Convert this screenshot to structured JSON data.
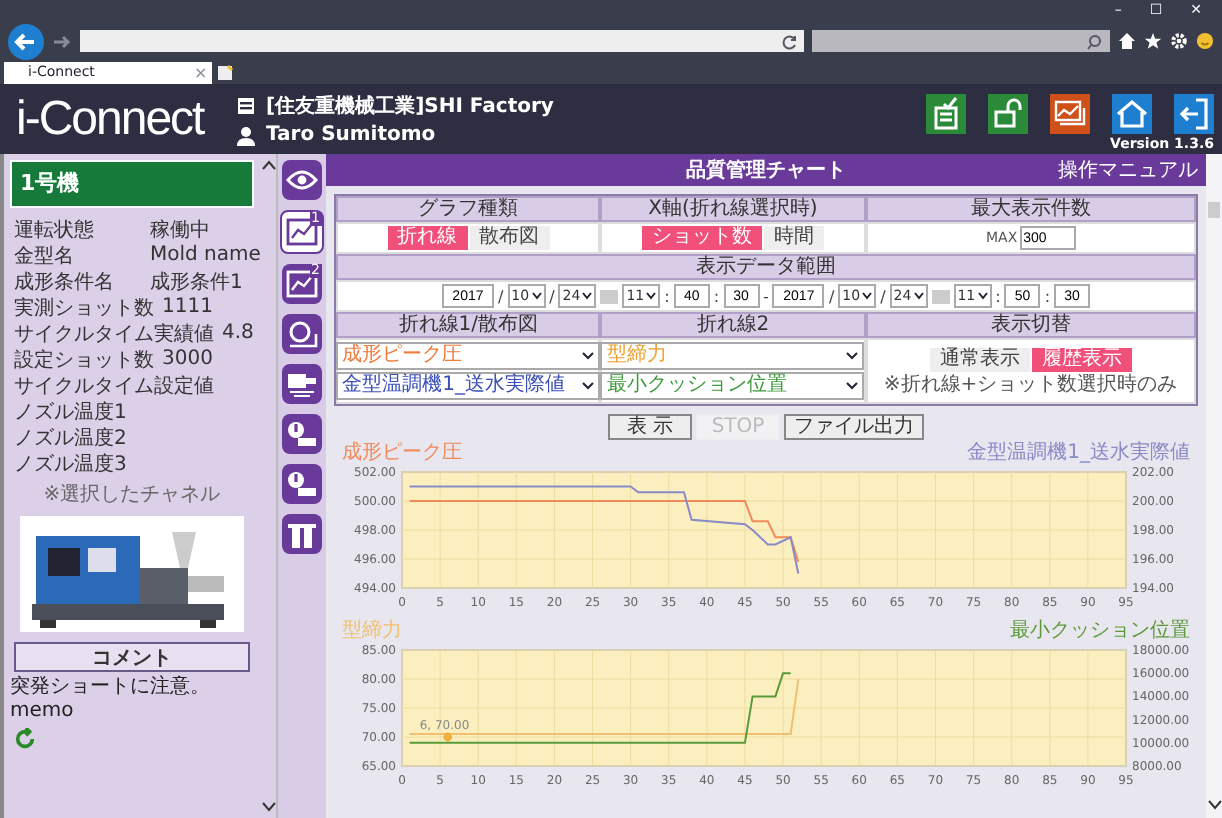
{
  "browser": {
    "tab_title": "i-Connect",
    "tab_close": "×",
    "window_controls": [
      "–",
      "☐",
      "✕"
    ]
  },
  "header": {
    "logo": "i-Connect",
    "factory": "[住友重機械工業]SHI Factory",
    "user": "Taro Sumitomo",
    "version": "Version 1.3.6"
  },
  "machine": {
    "name": "1号機",
    "fields": [
      {
        "label": "運転状態",
        "value": "稼働中"
      },
      {
        "label": "金型名",
        "value": "Mold name"
      },
      {
        "label": "成形条件名",
        "value": "成形条件1"
      },
      {
        "label": "実測ショット数",
        "value": "1111"
      },
      {
        "label": "サイクルタイム実績値",
        "value": "4.8"
      },
      {
        "label": "設定ショット数",
        "value": "3000"
      },
      {
        "label": "サイクルタイム設定値"
      },
      {
        "label": "ノズル温度1"
      },
      {
        "label": "ノズル温度2"
      },
      {
        "label": "ノズル温度3"
      }
    ],
    "note": "※選択したチャネル",
    "comment_button": "コメント",
    "memo": "突発ショートに注意。memo"
  },
  "nav_icons": [
    {
      "kind": "eye",
      "selected": false
    },
    {
      "kind": "chart",
      "selected": true,
      "badge": "1"
    },
    {
      "kind": "chart",
      "selected": false,
      "badge": "2"
    },
    {
      "kind": "search",
      "selected": false
    },
    {
      "kind": "machine",
      "selected": false
    },
    {
      "kind": "alert",
      "selected": false
    },
    {
      "kind": "alert",
      "selected": false
    },
    {
      "kind": "tool",
      "selected": false
    }
  ],
  "page": {
    "title": "品質管理チャート",
    "manual_link": "操作マニュアル"
  },
  "controls": {
    "graph_type": {
      "label": "グラフ種類",
      "options": [
        {
          "label": "折れ線",
          "selected": true
        },
        {
          "label": "散布図",
          "selected": false
        }
      ]
    },
    "x_axis": {
      "label": "X軸(折れ線選択時)",
      "options": [
        {
          "label": "ショット数",
          "selected": true
        },
        {
          "label": "時間",
          "selected": false
        }
      ]
    },
    "max_count": {
      "label": "最大表示件数",
      "prefix": "MAX",
      "value": "300"
    },
    "range": {
      "label": "表示データ範囲",
      "parts": [
        {
          "kind": "input",
          "text": "2017"
        },
        {
          "kind": "sep",
          "text": "/"
        },
        {
          "kind": "select",
          "text": "10"
        },
        {
          "kind": "sep",
          "text": "/"
        },
        {
          "kind": "select",
          "text": "24"
        },
        {
          "kind": "calendar"
        },
        {
          "kind": "select",
          "text": "11"
        },
        {
          "kind": "sep",
          "text": ":"
        },
        {
          "kind": "input",
          "text": "40"
        },
        {
          "kind": "sep",
          "text": ":"
        },
        {
          "kind": "input",
          "text": "30"
        },
        {
          "kind": "sep",
          "text": "-"
        },
        {
          "kind": "input",
          "text": "2017"
        },
        {
          "kind": "sep",
          "text": "/"
        },
        {
          "kind": "select",
          "text": "10"
        },
        {
          "kind": "sep",
          "text": "/"
        },
        {
          "kind": "select",
          "text": "24"
        },
        {
          "kind": "calendar"
        },
        {
          "kind": "select",
          "text": "11"
        },
        {
          "kind": "sep",
          "text": ":"
        },
        {
          "kind": "input",
          "text": "50"
        },
        {
          "kind": "sep",
          "text": ":"
        },
        {
          "kind": "input",
          "text": "30"
        }
      ]
    },
    "line1": {
      "label": "折れ線1/散布図",
      "selects": [
        {
          "value": "成形ピーク圧",
          "color": "#f07a3a"
        },
        {
          "value": "金型温調機1_送水実際値",
          "color": "#3a4fb8"
        }
      ]
    },
    "line2": {
      "label": "折れ線2",
      "selects": [
        {
          "value": "型締力",
          "color": "#f0a030"
        },
        {
          "value": "最小クッション位置",
          "color": "#3a9a3a"
        }
      ]
    },
    "display": {
      "label": "表示切替",
      "options": [
        {
          "label": "通常表示",
          "selected": false
        },
        {
          "label": "履歴表示",
          "selected": true
        }
      ],
      "note": "※折れ線+ショット数選択時のみ"
    }
  },
  "buttons": [
    {
      "label": "表 示",
      "disabled": false
    },
    {
      "label": "STOP",
      "disabled": true
    },
    {
      "label": "ファイル出力",
      "disabled": false
    }
  ],
  "charts": [
    {
      "chart_data": {
        "type": "line",
        "grid": true,
        "x": [
          1,
          30,
          31,
          37,
          38,
          45,
          46,
          48,
          49,
          51,
          52
        ],
        "xlim": [
          0,
          95
        ],
        "xticks": [
          0,
          5,
          10,
          15,
          20,
          25,
          30,
          35,
          40,
          45,
          50,
          55,
          60,
          65,
          70,
          75,
          80,
          85,
          90,
          95
        ],
        "ylim": [
          494,
          502
        ],
        "yticks": [
          {
            "value": 494,
            "label": "494.00"
          },
          {
            "value": 496,
            "label": "496.00"
          },
          {
            "value": 498,
            "label": "498.00"
          },
          {
            "value": 500,
            "label": "500.00"
          },
          {
            "value": 502,
            "label": "502.00"
          }
        ],
        "y2lim": [
          194,
          202
        ],
        "y2ticks": [
          {
            "value": 194,
            "label": "194.00"
          },
          {
            "value": 196,
            "label": "196.00"
          },
          {
            "value": 198,
            "label": "198.00"
          },
          {
            "value": 200,
            "label": "200.00"
          },
          {
            "value": 202,
            "label": "202.00"
          }
        ],
        "series": [
          {
            "name": "成形ピーク圧",
            "color": "#f08a5a",
            "values": [
              500,
              500,
              500,
              500,
              500,
              500,
              498.6,
              498.6,
              497.5,
              497.5,
              495.8
            ]
          },
          {
            "name": "金型温調機1_送水実際値",
            "color": "#8a8ac8",
            "axis": "y2",
            "values": [
              201,
              201,
              200.6,
              200.6,
              198.7,
              198.4,
              198,
              197,
              197,
              197.5,
              195
            ]
          }
        ]
      }
    },
    {
      "chart_data": {
        "type": "line",
        "grid": true,
        "x": [
          1,
          45,
          46,
          49,
          50,
          51,
          52
        ],
        "xlim": [
          0,
          95
        ],
        "xticks": [
          0,
          5,
          10,
          15,
          20,
          25,
          30,
          35,
          40,
          45,
          50,
          55,
          60,
          65,
          70,
          75,
          80,
          85,
          90,
          95
        ],
        "ylim": [
          65,
          85
        ],
        "yticks": [
          {
            "value": 65,
            "label": "65.00"
          },
          {
            "value": 70,
            "label": "70.00"
          },
          {
            "value": 75,
            "label": "75.00"
          },
          {
            "value": 80,
            "label": "80.00"
          },
          {
            "value": 85,
            "label": "85.00"
          }
        ],
        "y2lim": [
          8000,
          18000
        ],
        "y2ticks": [
          {
            "value": 8000,
            "label": "8000.00"
          },
          {
            "value": 10000,
            "label": "10000.00"
          },
          {
            "value": 12000,
            "label": "12000.00"
          },
          {
            "value": 14000,
            "label": "14000.00"
          },
          {
            "value": 16000,
            "label": "16000.00"
          },
          {
            "value": 18000,
            "label": "18000.00"
          }
        ],
        "series": [
          {
            "name": "型締力",
            "color": "#f0c070",
            "values": [
              70.5,
              70.5,
              70.5,
              70.5,
              70.5,
              70.5,
              80
            ]
          },
          {
            "name": "最小クッション位置",
            "color": "#5a9a3a",
            "axis": "y2",
            "values": [
              10000,
              10000,
              14000,
              14000,
              16000,
              16000,
              null
            ]
          }
        ],
        "annotations": [
          {
            "x": 6,
            "y": 70,
            "text": "6, 70.00"
          }
        ]
      }
    }
  ]
}
